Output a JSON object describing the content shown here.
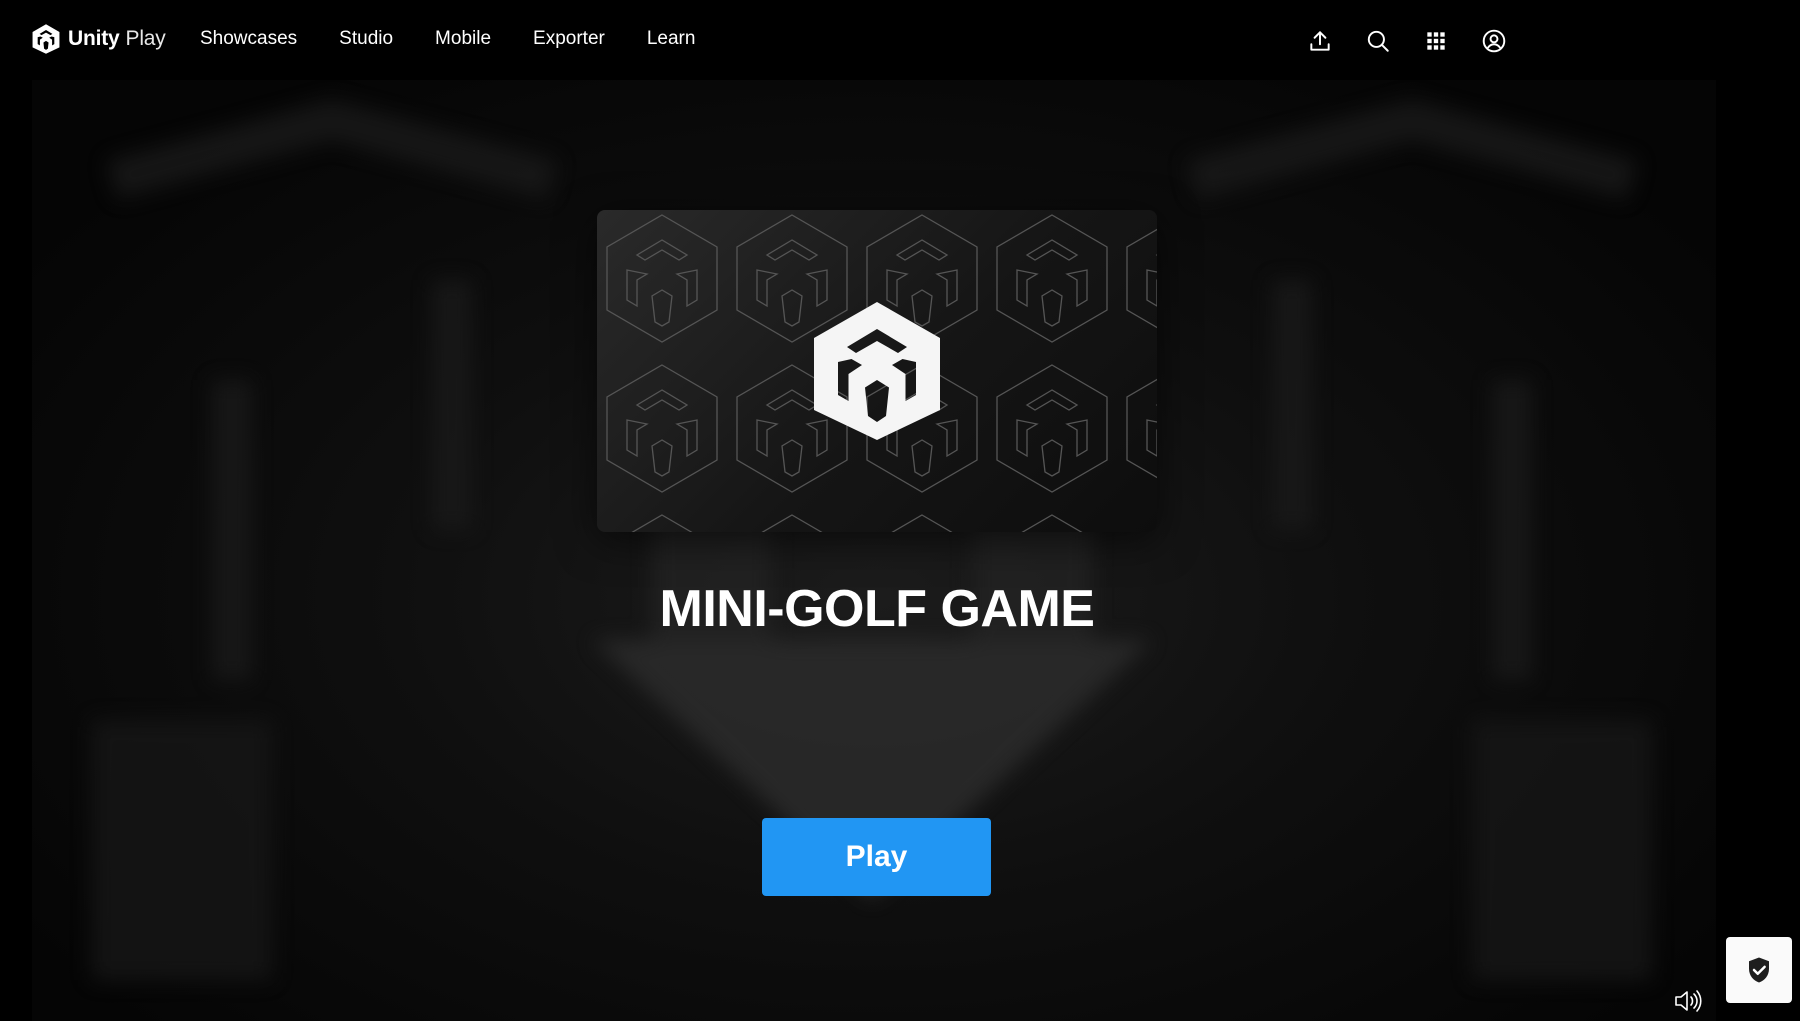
{
  "brand": {
    "name_bold": "Unity",
    "name_light": "Play",
    "logo_icon": "unity-cube-logo"
  },
  "nav": {
    "items": [
      {
        "label": "Showcases"
      },
      {
        "label": "Studio"
      },
      {
        "label": "Mobile"
      },
      {
        "label": "Exporter"
      },
      {
        "label": "Learn"
      }
    ]
  },
  "header_icons": [
    "upload-icon",
    "search-icon",
    "apps-grid-icon",
    "account-icon"
  ],
  "game": {
    "title": "MINI-GOLF GAME",
    "thumbnail_icon": "unity-cube-logo",
    "play_label": "Play"
  },
  "footer_icons": [
    "sound-icon",
    "privacy-shield-icon"
  ],
  "colors": {
    "background": "#000000",
    "play_button": "#2196f3",
    "text": "#ffffff"
  }
}
